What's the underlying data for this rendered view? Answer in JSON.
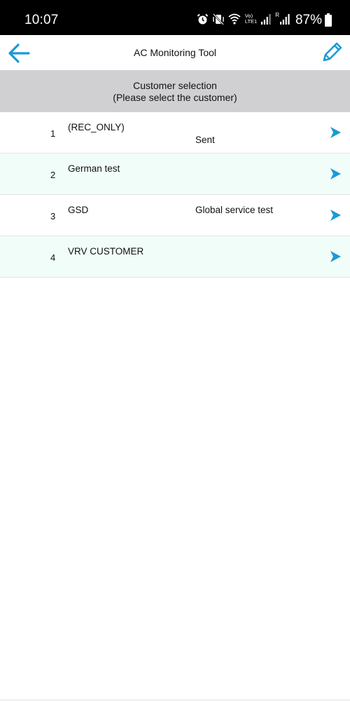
{
  "status_bar": {
    "time": "10:07",
    "network_label_top": "Vo)",
    "network_label_bottom": "LTE1",
    "roaming_label": "R",
    "battery_percent": "87%"
  },
  "app_bar": {
    "title": "AC Monitoring Tool",
    "back_icon": "arrow-left-icon",
    "edit_icon": "pencil-icon"
  },
  "header": {
    "line1": "Customer selection",
    "line2": "(Please select the customer)"
  },
  "customers": [
    {
      "number": "1",
      "name": "(REC_ONLY)",
      "description": "Sent"
    },
    {
      "number": "2",
      "name": "German test",
      "description": ""
    },
    {
      "number": "3",
      "name": "GSD",
      "description": "Global service test"
    },
    {
      "number": "4",
      "name": "VRV CUSTOMER",
      "description": ""
    }
  ],
  "colors": {
    "accent": "#1a9ad6",
    "header_bg": "#d0d0d3",
    "row_alt_bg": "#f1fdf9"
  }
}
